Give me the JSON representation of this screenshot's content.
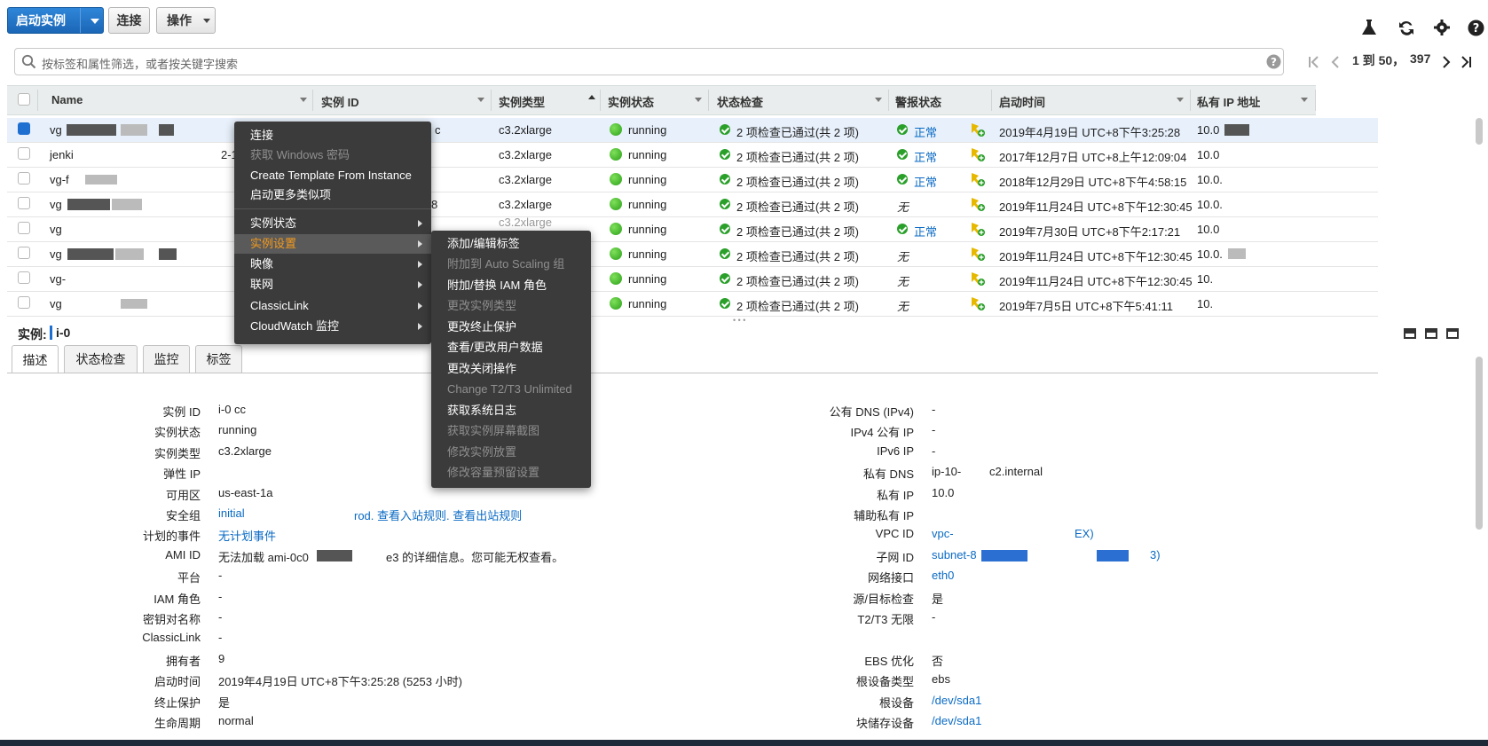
{
  "toolbar": {
    "launch_label": "启动实例",
    "connect_label": "连接",
    "actions_label": "操作"
  },
  "search": {
    "placeholder": "按标签和属性筛选，或者按关键字搜索",
    "pager_text": "1 到 50，",
    "pager_total": "397"
  },
  "table": {
    "columns": [
      "Name",
      "实例 ID",
      "实例类型",
      "实例状态",
      "状态检查",
      "警报状态",
      "启动时间",
      "私有 IP 地址"
    ],
    "rows": [
      {
        "name": "vg",
        "type": "c3.2xlarge",
        "state": "running",
        "checks": "2 项检查已通过(共 2 项)",
        "alarm": "正常",
        "launch": "2019年4月19日 UTC+8下午3:25:28",
        "ip": "10.0",
        "id_frag": "c"
      },
      {
        "name": "jenki",
        "type": "c3.2xlarge",
        "state": "running",
        "checks": "2 项检查已通过(共 2 项)",
        "alarm": "正常",
        "launch": "2017年12月7日 UTC+8上午12:09:04",
        "ip": "10.0",
        "id_frag": "2-1"
      },
      {
        "name": "vg-f",
        "type": "c3.2xlarge",
        "state": "running",
        "checks": "2 项检查已通过(共 2 项)",
        "alarm": "正常",
        "launch": "2018年12月29日 UTC+8下午4:58:15",
        "ip": "10.0.",
        "id_frag": ""
      },
      {
        "name": "vg",
        "type": "c3.2xlarge",
        "state": "running",
        "checks": "2 项检查已通过(共 2 项)",
        "alarm": "无",
        "launch": "2019年11月24日 UTC+8下午12:30:45",
        "ip": "10.0.",
        "id_frag": "8"
      },
      {
        "name": "vg",
        "type": "c3.2xlarge",
        "state": "running",
        "checks": "2 项检查已通过(共 2 项)",
        "alarm": "正常",
        "launch": "2019年7月30日 UTC+8下午2:17:21",
        "ip": "10.0",
        "id_frag": ""
      },
      {
        "name": "vg",
        "type": "",
        "state": "running",
        "checks": "2 项检查已通过(共 2 项)",
        "alarm": "无",
        "launch": "2019年11月24日 UTC+8下午12:30:45",
        "ip": "10.0.",
        "id_frag": ""
      },
      {
        "name": "vg-",
        "type": "",
        "state": "running",
        "checks": "2 项检查已通过(共 2 项)",
        "alarm": "无",
        "launch": "2019年11月24日 UTC+8下午12:30:45",
        "ip": "10.",
        "id_frag": ""
      },
      {
        "name": "vg",
        "type": "",
        "state": "running",
        "checks": "2 项检查已通过(共 2 项)",
        "alarm": "无",
        "launch": "2019年7月5日 UTC+8下午5:41:11",
        "ip": "10.",
        "id_frag": ""
      }
    ]
  },
  "context_menu": {
    "items": [
      "连接",
      "获取 Windows 密码",
      "Create Template From Instance",
      "启动更多类似项",
      "实例状态",
      "实例设置",
      "映像",
      "联网",
      "ClassicLink",
      "CloudWatch 监控"
    ]
  },
  "submenu": {
    "items": [
      "添加/编辑标签",
      "附加到 Auto Scaling 组",
      "附加/替换 IAM 角色",
      "更改实例类型",
      "更改终止保护",
      "查看/更改用户数据",
      "更改关闭操作",
      "Change T2/T3 Unlimited",
      "获取系统日志",
      "获取实例屏幕截图",
      "修改实例放置",
      "修改容量预留设置"
    ]
  },
  "detail": {
    "instance_label": "实例:",
    "instance_id": "i-0",
    "tabs": [
      "描述",
      "状态检查",
      "监控",
      "标签"
    ],
    "left": [
      {
        "label": "实例 ID",
        "value": "i-0                                    cc"
      },
      {
        "label": "实例状态",
        "value": "running"
      },
      {
        "label": "实例类型",
        "value": "c3.2xlarge"
      },
      {
        "label": "弹性 IP",
        "value": ""
      },
      {
        "label": "可用区",
        "value": "us-east-1a"
      },
      {
        "label": "安全组",
        "value": "initial",
        "link2": "rod. 查看入站规则. 查看出站规则"
      },
      {
        "label": "计划的事件",
        "value": "无计划事件"
      },
      {
        "label": "AMI ID",
        "value": "无法加载 ami-0c0",
        "value2": "e3 的详细信息。您可能无权查看。"
      },
      {
        "label": "平台",
        "value": "-"
      },
      {
        "label": "IAM 角色",
        "value": "-"
      },
      {
        "label": "密钥对名称",
        "value": "-"
      },
      {
        "label": "ClassicLink",
        "value": "-"
      },
      {
        "label": "拥有者",
        "value": "9"
      },
      {
        "label": "启动时间",
        "value": "2019年4月19日 UTC+8下午3:25:28 (5253 小时)"
      },
      {
        "label": "终止保护",
        "value": "是"
      },
      {
        "label": "生命周期",
        "value": "normal"
      }
    ],
    "right": [
      {
        "label": "公有 DNS (IPv4)",
        "value": "-"
      },
      {
        "label": "IPv4 公有 IP",
        "value": "-"
      },
      {
        "label": "IPv6 IP",
        "value": "-"
      },
      {
        "label": "私有 DNS",
        "value": "ip-10-",
        "value2": "c2.internal"
      },
      {
        "label": "私有 IP",
        "value": "10.0"
      },
      {
        "label": "辅助私有 IP",
        "value": ""
      },
      {
        "label": "VPC ID",
        "value": "vpc-",
        "value2": "EX)"
      },
      {
        "label": "子网 ID",
        "value": "subnet-8",
        "value2": "3)"
      },
      {
        "label": "网络接口",
        "value": "eth0"
      },
      {
        "label": "源/目标检查",
        "value": "是"
      },
      {
        "label": "T2/T3 无限",
        "value": "-"
      },
      {
        "label": "",
        "value": ""
      },
      {
        "label": "EBS 优化",
        "value": "否"
      },
      {
        "label": "根设备类型",
        "value": "ebs"
      },
      {
        "label": "根设备",
        "value": "/dev/sda1"
      },
      {
        "label": "块储存设备",
        "value": "/dev/sda1"
      }
    ]
  },
  "colors": {
    "accent": "#1f6fd1",
    "menu_bg": "#3b3b3b",
    "menu_highlight": "#f39a1e",
    "ok_green": "#2aa02a"
  }
}
